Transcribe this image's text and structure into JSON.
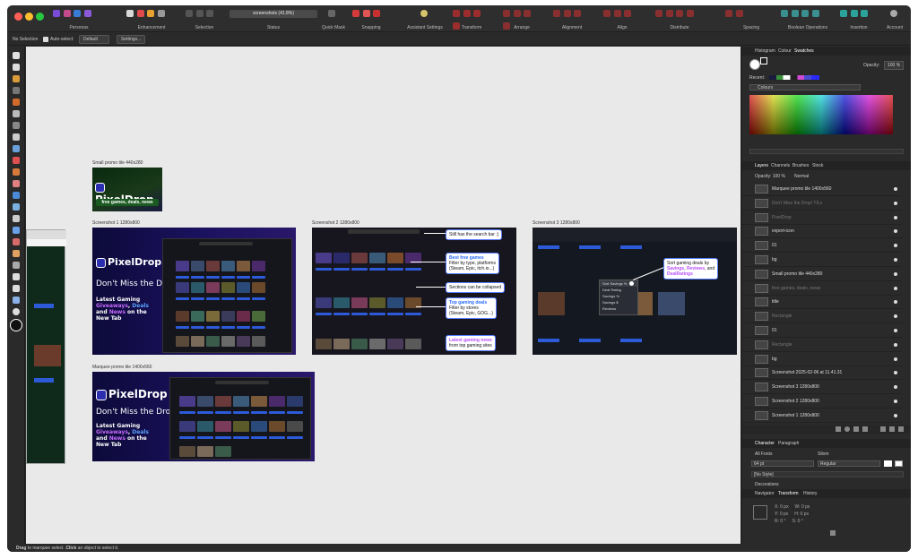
{
  "titlebar": {
    "personas_label": "Personas",
    "groups": [
      "Enhancement",
      "Selection",
      "Status",
      "Quick Mask",
      "Snapping",
      "Assistant Settings",
      "Transform",
      "Arrange",
      "Alignment",
      "Align",
      "Distribute",
      "Spacing",
      "Boolean Operations",
      "Insertion",
      "Account"
    ],
    "status_field": "screenshots (41.8%)"
  },
  "context_bar": {
    "selection": "No Selection",
    "auto_select": "Auto-select:",
    "auto_select_value": "Default",
    "settings_button": "Settings..."
  },
  "canvas": {
    "artboards": {
      "small": {
        "label": "Small promo tile 440x280",
        "logo": "PixelDrop",
        "sub": "free games, deals, news"
      },
      "s1": {
        "label": "Screenshot 1 1280x800",
        "logo": "PixelDrop",
        "tagline": "Don't Miss the Drop!",
        "sub_pre": "Latest Gaming ",
        "sub_g": "Giveaways",
        "sub_c": ",",
        "sub_d": "Deals",
        "sub_and": " and ",
        "sub_n": "News",
        "sub_post": " on the New Tab"
      },
      "s2": {
        "label": "Screenshot 2 1280x800"
      },
      "s3": {
        "label": "Screenshot 3 1280x800"
      },
      "marquee": {
        "label": "Marquee promo tile 1400x560",
        "logo": "PixelDrop",
        "tagline": "Don't Miss the Drop!",
        "sub_pre": "Latest Gaming ",
        "sub_g": "Giveaways",
        "sub_c": ",",
        "sub_d": "Deals",
        "sub_and": " and ",
        "sub_n": "News",
        "sub_post": " on the New Tab"
      }
    },
    "callouts": {
      "search": "Still has the search bar ;)",
      "free_title": "Best free games",
      "free_l1": "Filter by type, platforms",
      "free_l2": "(Steam, Epic, itch.io...)",
      "collapse": "Sections can be collapsed",
      "deals_title": "Top gaming deals",
      "deals_l1": "Filter by stores",
      "deals_l2": "(Steam, Epic, GOG...)",
      "news_title": "Latest gaming news",
      "news_l1": "from top gaming sites",
      "sort_l1": "Sort gaming deals by",
      "sort_savings": "Savings",
      "sort_reviews": "Reviews",
      "sort_and": ", and",
      "sort_dealratings": "DealRatings",
      "sort_menu": [
        "Sort Savings %",
        "Deal Rating",
        "Savings %",
        "Savings $",
        "Reviews"
      ]
    }
  },
  "right_panel": {
    "tabs_top": [
      "Histogram",
      "Colour",
      "Swatches"
    ],
    "opacity_label": "Opacity:",
    "opacity_value": "100 %",
    "recent_label": "Recent:",
    "palette_name": "Colours",
    "layers_tabs": [
      "Layers",
      "Channels",
      "Brushes",
      "Stock"
    ],
    "layers_opacity": "Opacity: 100 %",
    "blend": "Normal",
    "layers": [
      {
        "name": "Marquee promo tile 1400x560",
        "dim": false
      },
      {
        "name": "Don't Miss the Drop! TILs",
        "dim": true
      },
      {
        "name": "PixelDrop",
        "dim": true
      },
      {
        "name": "export-icon",
        "dim": false
      },
      {
        "name": "01",
        "dim": false
      },
      {
        "name": "bg",
        "dim": false
      },
      {
        "name": "Small promo tile 440x280",
        "dim": false
      },
      {
        "name": "free games, deals, news",
        "dim": true
      },
      {
        "name": "title",
        "dim": false
      },
      {
        "name": "Rectangle",
        "dim": true
      },
      {
        "name": "01",
        "dim": false
      },
      {
        "name": "Rectangle",
        "dim": true
      },
      {
        "name": "bg",
        "dim": false
      },
      {
        "name": "Screenshot 2025-02-06 at 11.41.31",
        "dim": false
      },
      {
        "name": "Screenshot 3 1280x800",
        "dim": false
      },
      {
        "name": "Screenshot 2 1280x800",
        "dim": false
      },
      {
        "name": "Screenshot 1 1280x800",
        "dim": false
      }
    ],
    "char_tabs": [
      "Character",
      "Paragraph"
    ],
    "font_collection": "All Fonts",
    "font_family": "Silom",
    "font_size": "64 pt",
    "font_style": "Regular",
    "char_style": "[No Style]",
    "decorations": "Decorations",
    "nav_tabs": [
      "Navigator",
      "Transform",
      "History"
    ],
    "transform": {
      "x": "0 px",
      "y": "0 px",
      "w": "0 px",
      "h": "0 px",
      "r": "0 °",
      "s": "0 °"
    }
  },
  "status": {
    "drag": "Drag",
    "text1": " to marquee select. ",
    "click": "Click",
    "text2": " an object to select it."
  }
}
